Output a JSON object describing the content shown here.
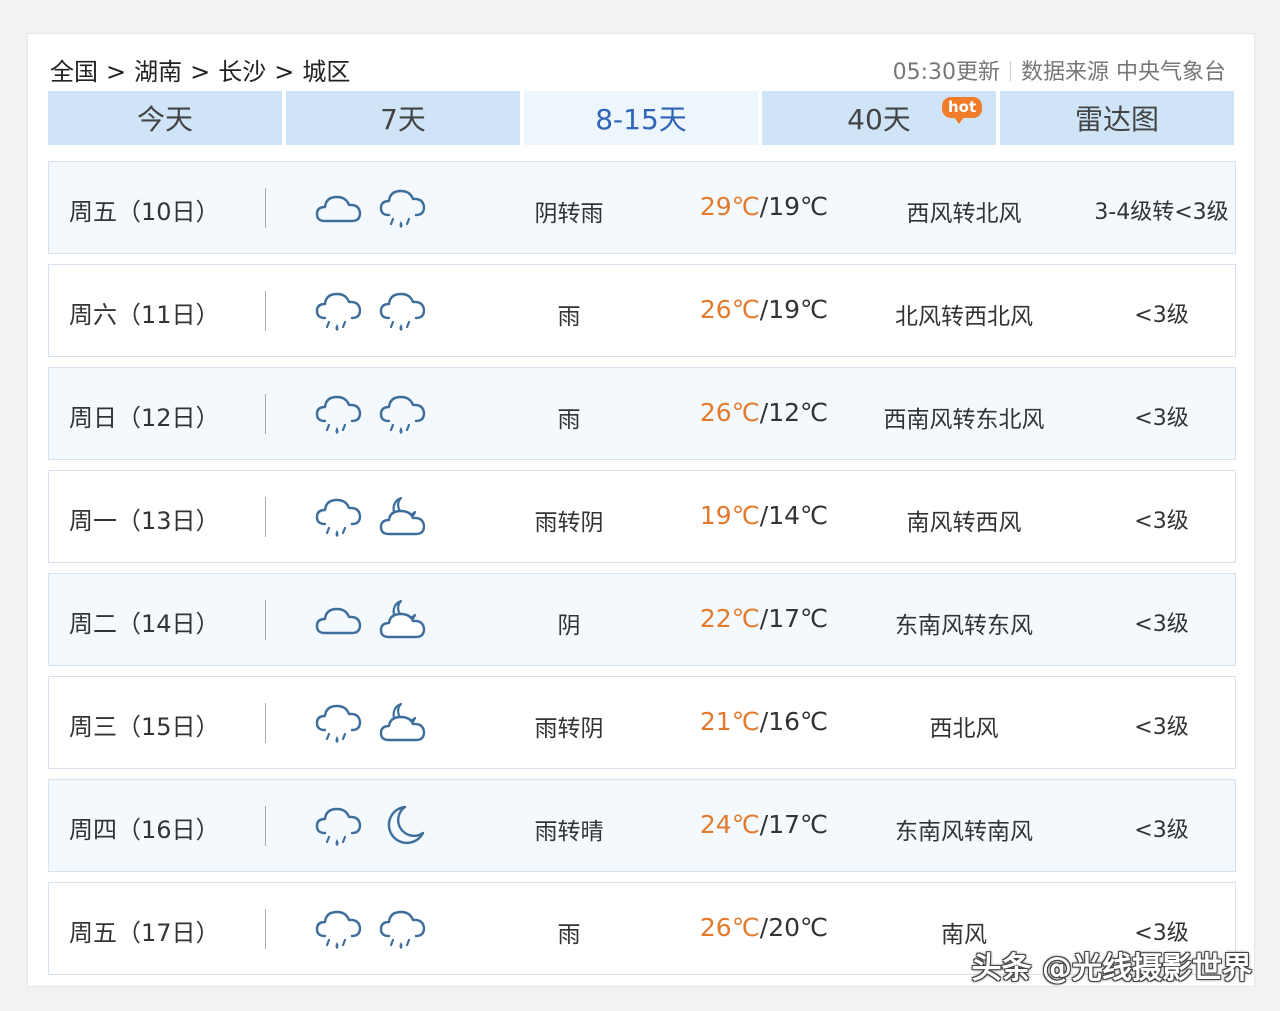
{
  "breadcrumb": [
    "全国",
    "湖南",
    "长沙",
    "城区"
  ],
  "breadcrumb_separator": ">",
  "meta": {
    "update_time": "05:30更新",
    "source": "数据来源 中央气象台"
  },
  "tabs": [
    {
      "label": "今天"
    },
    {
      "label": "7天"
    },
    {
      "label": "8-15天",
      "active": true
    },
    {
      "label": "40天",
      "badge": "hot"
    },
    {
      "label": "雷达图"
    }
  ],
  "colors": {
    "tab_bg": "#cfe5f7",
    "tab_active_text": "#2f64b7",
    "high_temp": "#e37b2e",
    "hot_badge": "#f07b28",
    "icon_stroke": "#3d6e9c"
  },
  "forecast": [
    {
      "day": "周五（10日）",
      "icon_day": "cloudy-icon",
      "icon_night": "rain-icon",
      "condition": "阴转雨",
      "high": "29℃",
      "low": "19℃",
      "wind": "西风转北风",
      "level": "3-4级转<3级"
    },
    {
      "day": "周六（11日）",
      "icon_day": "rain-icon",
      "icon_night": "rain-icon",
      "condition": "雨",
      "high": "26℃",
      "low": "19℃",
      "wind": "北风转西北风",
      "level": "<3级"
    },
    {
      "day": "周日（12日）",
      "icon_day": "rain-icon",
      "icon_night": "rain-icon",
      "condition": "雨",
      "high": "26℃",
      "low": "12℃",
      "wind": "西南风转东北风",
      "level": "<3级"
    },
    {
      "day": "周一（13日）",
      "icon_day": "rain-icon",
      "icon_night": "cloudy-night-icon",
      "condition": "雨转阴",
      "high": "19℃",
      "low": "14℃",
      "wind": "南风转西风",
      "level": "<3级"
    },
    {
      "day": "周二（14日）",
      "icon_day": "cloudy-icon",
      "icon_night": "cloudy-night-icon",
      "condition": "阴",
      "high": "22℃",
      "low": "17℃",
      "wind": "东南风转东风",
      "level": "<3级"
    },
    {
      "day": "周三（15日）",
      "icon_day": "rain-icon",
      "icon_night": "cloudy-night-icon",
      "condition": "雨转阴",
      "high": "21℃",
      "low": "16℃",
      "wind": "西北风",
      "level": "<3级"
    },
    {
      "day": "周四（16日）",
      "icon_day": "rain-icon",
      "icon_night": "moon-icon",
      "condition": "雨转晴",
      "high": "24℃",
      "low": "17℃",
      "wind": "东南风转南风",
      "level": "<3级"
    },
    {
      "day": "周五（17日）",
      "icon_day": "rain-icon",
      "icon_night": "rain-icon",
      "condition": "雨",
      "high": "26℃",
      "low": "20℃",
      "wind": "南风",
      "level": "<3级"
    }
  ],
  "watermark": "头条 @光线摄影世界"
}
